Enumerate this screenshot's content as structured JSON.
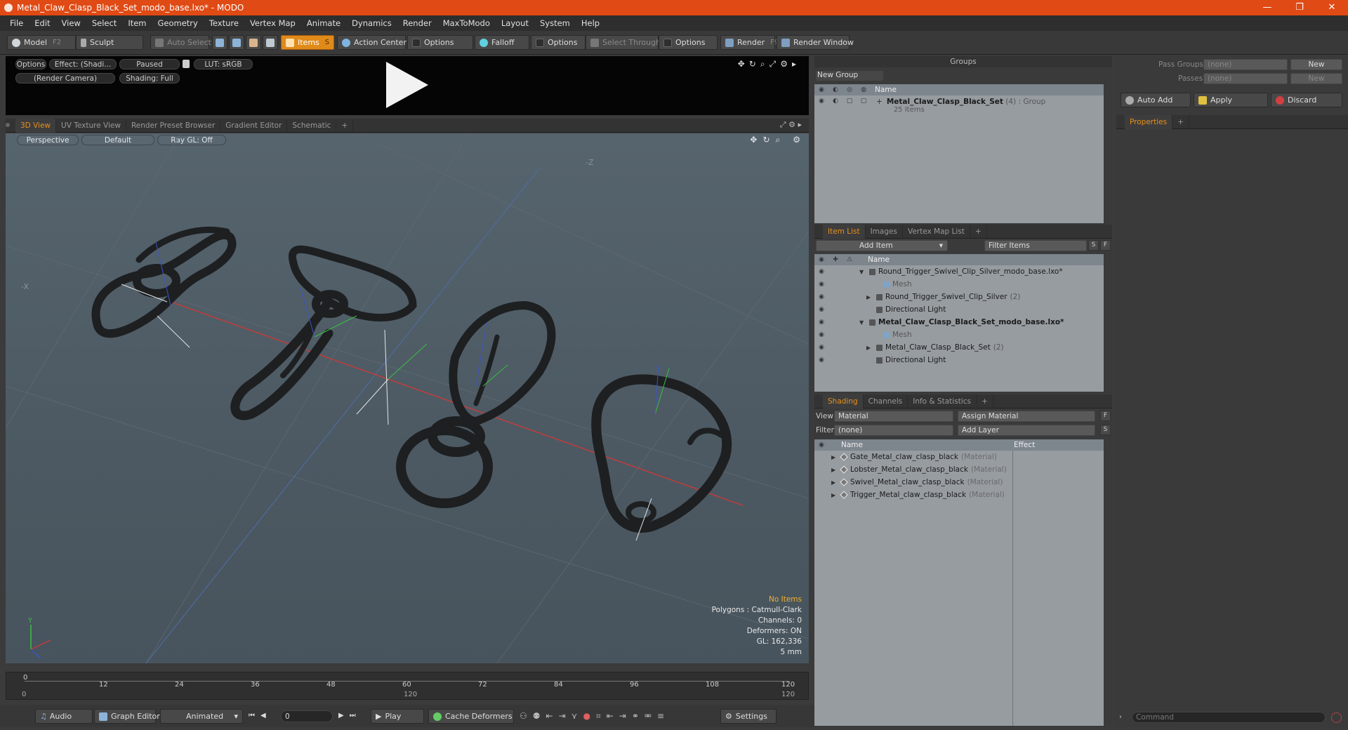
{
  "window": {
    "title": "Metal_Claw_Clasp_Black_Set_modo_base.lxo* - MODO",
    "minimize": "—",
    "maximize": "❐",
    "close": "✕"
  },
  "menu": [
    "File",
    "Edit",
    "View",
    "Select",
    "Item",
    "Geometry",
    "Texture",
    "Vertex Map",
    "Animate",
    "Dynamics",
    "Render",
    "MaxToModo",
    "Layout",
    "System",
    "Help"
  ],
  "toolbar": {
    "model": "Model",
    "model_key": "F2",
    "sculpt": "Sculpt",
    "auto_select": "Auto Select",
    "items": "Items",
    "items_key": "S",
    "action_center": "Action Center",
    "options1": "Options",
    "falloff": "Falloff",
    "options2": "Options",
    "select_through": "Select Through",
    "options3": "Options",
    "render": "Render",
    "render_key": "F9",
    "render_window": "Render Window"
  },
  "preview": {
    "options": "Options",
    "effect": "Effect: (Shadi...",
    "paused": "Paused",
    "lut": "LUT: sRGB",
    "camera": "(Render Camera)",
    "shading": "Shading: Full"
  },
  "viewport_tabs": [
    "3D View",
    "UV Texture View",
    "Render Preset Browser",
    "Gradient Editor",
    "Schematic",
    "+"
  ],
  "viewport": {
    "perspective": "Perspective",
    "default": "Default",
    "raygl": "Ray GL: Off",
    "axis_neg_z": "-Z",
    "axis_neg_x": "-X",
    "axis_y": "Y",
    "stats": {
      "no_items": "No Items",
      "polygons": "Polygons : Catmull-Clark",
      "channels": "Channels: 0",
      "deformers": "Deformers: ON",
      "gl": "GL: 162,336",
      "scale": "5 mm"
    }
  },
  "timeline": {
    "ticks": [
      "0",
      "12",
      "24",
      "36",
      "48",
      "60",
      "72",
      "84",
      "96",
      "108",
      "120"
    ],
    "start": "0",
    "mid": "120",
    "end": "120"
  },
  "bottombar": {
    "audio": "Audio",
    "graph_editor": "Graph Editor",
    "animated": "Animated",
    "frame": "0",
    "play": "Play",
    "cache_deformers": "Cache Deformers",
    "settings": "Settings"
  },
  "groups": {
    "title": "Groups",
    "new_group": "New Group",
    "col_name": "Name",
    "item_name": "Metal_Claw_Clasp_Black_Set",
    "item_count": "(4)",
    "item_type": ": Group",
    "item_sub": "25 Items"
  },
  "item_list": {
    "tabs": [
      "Item List",
      "Images",
      "Vertex Map List",
      "+"
    ],
    "add_item": "Add Item",
    "filter": "Filter Items",
    "s": "S",
    "f": "F",
    "col_name": "Name",
    "rows": [
      {
        "label": "Round_Trigger_Swivel_Clip_Silver_modo_base.lxo*",
        "indent": 0,
        "style": "normal",
        "expand": "▼"
      },
      {
        "label": "Mesh",
        "indent": 2,
        "style": "gray",
        "expand": ""
      },
      {
        "label": "Round_Trigger_Swivel_Clip_Silver",
        "suffix": "(2)",
        "indent": 1,
        "style": "normal",
        "expand": "▶"
      },
      {
        "label": "Directional Light",
        "indent": 1,
        "style": "normal",
        "expand": ""
      },
      {
        "label": "Metal_Claw_Clasp_Black_Set_modo_base.lxo*",
        "indent": 0,
        "style": "bold",
        "expand": "▼"
      },
      {
        "label": "Mesh",
        "indent": 2,
        "style": "gray",
        "expand": ""
      },
      {
        "label": "Metal_Claw_Clasp_Black_Set",
        "suffix": "(2)",
        "indent": 1,
        "style": "normal",
        "expand": "▶"
      },
      {
        "label": "Directional Light",
        "indent": 1,
        "style": "normal",
        "expand": ""
      }
    ]
  },
  "shading": {
    "tabs": [
      "Shading",
      "Channels",
      "Info & Statistics",
      "+"
    ],
    "view_label": "View",
    "view_value": "Material",
    "assign_material": "Assign Material",
    "f": "F",
    "filter_label": "Filter",
    "filter_value": "(none)",
    "add_layer": "Add Layer",
    "s": "S",
    "col_name": "Name",
    "col_effect": "Effect",
    "rows": [
      {
        "label": "Gate_Metal_claw_clasp_black",
        "type": "(Material)"
      },
      {
        "label": "Lobster_Metal_claw_clasp_black",
        "type": "(Material)"
      },
      {
        "label": "Swivel_Metal_claw_clasp_black",
        "type": "(Material)"
      },
      {
        "label": "Trigger_Metal_claw_clasp_black",
        "type": "(Material)"
      }
    ]
  },
  "right": {
    "pass_groups": "Pass Groups",
    "pass_groups_value": "(none)",
    "new1": "New",
    "passes": "Passes",
    "passes_value": "(none)",
    "new2": "New",
    "auto_add": "Auto Add",
    "apply": "Apply",
    "discard": "Discard",
    "properties": "Properties",
    "plus": "+",
    "command": "Command"
  },
  "colors": {
    "accent": "#e04a14",
    "active_tab": "#e8901e",
    "stat_highlight": "#f0b030"
  }
}
